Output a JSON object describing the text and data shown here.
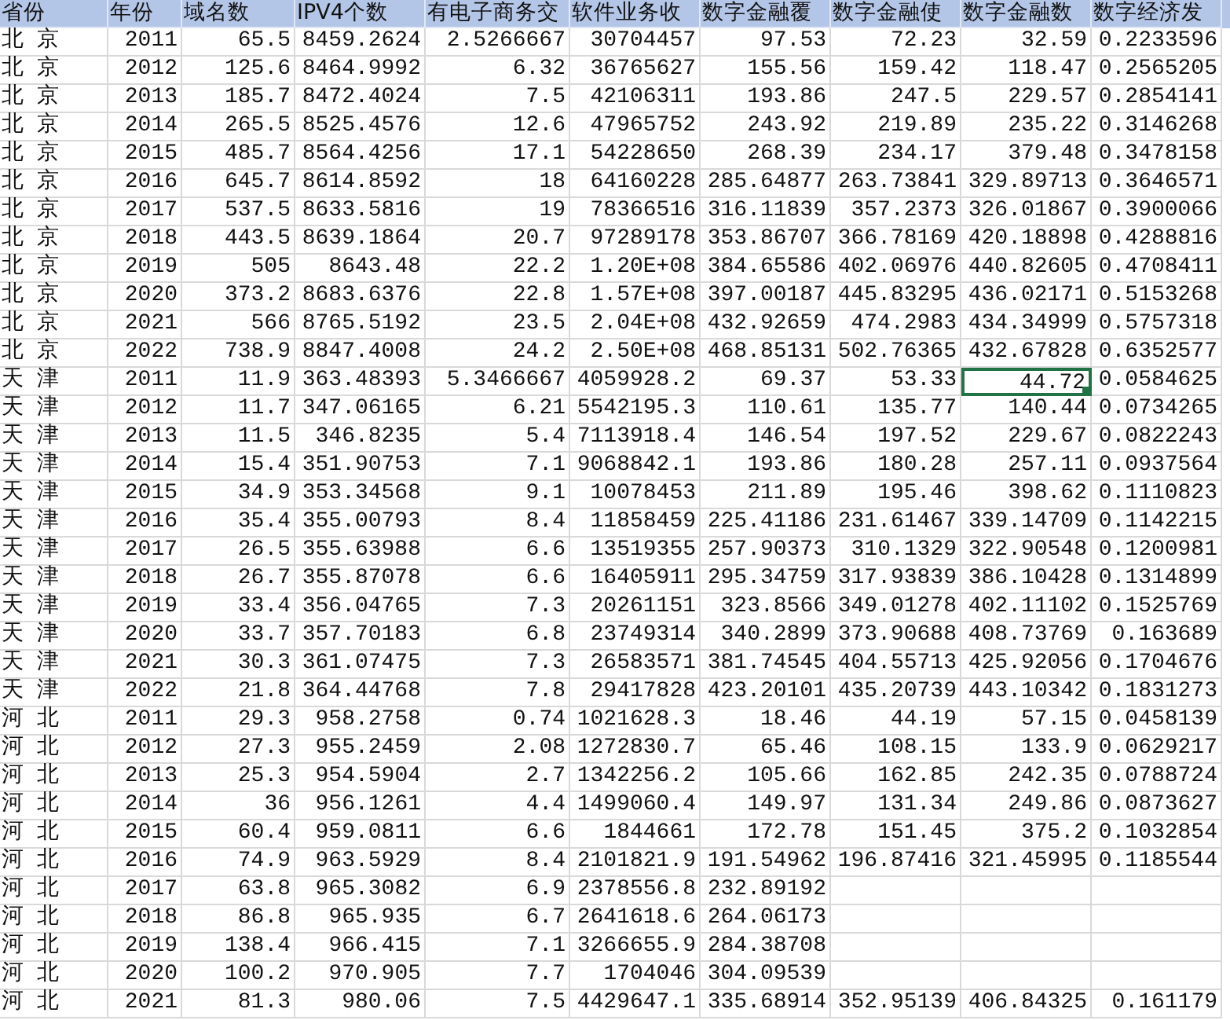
{
  "header": [
    "省份",
    "年份",
    "域名数",
    "IPV4个数",
    "有电子商务交",
    "软件业务收",
    "数字金融覆",
    "数字金融使",
    "数字金融数",
    "数字经济发"
  ],
  "rows": [
    {
      "cells": [
        "北 京",
        "2011",
        "65.5",
        "8459.2624",
        "2.5266667",
        "30704457",
        "97.53",
        "72.23",
        "32.59",
        "0.2233596"
      ]
    },
    {
      "cells": [
        "北 京",
        "2012",
        "125.6",
        "8464.9992",
        "6.32",
        "36765627",
        "155.56",
        "159.42",
        "118.47",
        "0.2565205"
      ]
    },
    {
      "cells": [
        "北 京",
        "2013",
        "185.7",
        "8472.4024",
        "7.5",
        "42106311",
        "193.86",
        "247.5",
        "229.57",
        "0.2854141"
      ]
    },
    {
      "cells": [
        "北 京",
        "2014",
        "265.5",
        "8525.4576",
        "12.6",
        "47965752",
        "243.92",
        "219.89",
        "235.22",
        "0.3146268"
      ]
    },
    {
      "cells": [
        "北 京",
        "2015",
        "485.7",
        "8564.4256",
        "17.1",
        "54228650",
        "268.39",
        "234.17",
        "379.48",
        "0.3478158"
      ]
    },
    {
      "cells": [
        "北 京",
        "2016",
        "645.7",
        "8614.8592",
        "18",
        "64160228",
        "285.64877",
        "263.73841",
        "329.89713",
        "0.3646571"
      ]
    },
    {
      "cells": [
        "北 京",
        "2017",
        "537.5",
        "8633.5816",
        "19",
        "78366516",
        "316.11839",
        "357.2373",
        "326.01867",
        "0.3900066"
      ]
    },
    {
      "cells": [
        "北 京",
        "2018",
        "443.5",
        "8639.1864",
        "20.7",
        "97289178",
        "353.86707",
        "366.78169",
        "420.18898",
        "0.4288816"
      ]
    },
    {
      "cells": [
        "北 京",
        "2019",
        "505",
        "8643.48",
        "22.2",
        "1.20E+08",
        "384.65586",
        "402.06976",
        "440.82605",
        "0.4708411"
      ]
    },
    {
      "cells": [
        "北 京",
        "2020",
        "373.2",
        "8683.6376",
        "22.8",
        "1.57E+08",
        "397.00187",
        "445.83295",
        "436.02171",
        "0.5153268"
      ]
    },
    {
      "cells": [
        "北 京",
        "2021",
        "566",
        "8765.5192",
        "23.5",
        "2.04E+08",
        "432.92659",
        "474.2983",
        "434.34999",
        "0.5757318"
      ]
    },
    {
      "cells": [
        "北 京",
        "2022",
        "738.9",
        "8847.4008",
        "24.2",
        "2.50E+08",
        "468.85131",
        "502.76365",
        "432.67828",
        "0.6352577"
      ]
    },
    {
      "cells": [
        "天 津",
        "2011",
        "11.9",
        "363.48393",
        "5.3466667",
        "4059928.2",
        "69.37",
        "53.33",
        {
          "text": "44.72",
          "selected": true
        },
        "0.0584625"
      ]
    },
    {
      "cells": [
        "天 津",
        "2012",
        "11.7",
        "347.06165",
        "6.21",
        "5542195.3",
        "110.61",
        "135.77",
        "140.44",
        "0.0734265"
      ]
    },
    {
      "cells": [
        "天 津",
        "2013",
        "11.5",
        "346.8235",
        "5.4",
        "7113918.4",
        "146.54",
        "197.52",
        "229.67",
        "0.0822243"
      ]
    },
    {
      "cells": [
        "天 津",
        "2014",
        "15.4",
        "351.90753",
        "7.1",
        "9068842.1",
        "193.86",
        "180.28",
        "257.11",
        "0.0937564"
      ]
    },
    {
      "cells": [
        "天 津",
        "2015",
        "34.9",
        "353.34568",
        "9.1",
        "10078453",
        "211.89",
        "195.46",
        "398.62",
        "0.1110823"
      ]
    },
    {
      "cells": [
        "天 津",
        "2016",
        "35.4",
        "355.00793",
        "8.4",
        "11858459",
        "225.41186",
        "231.61467",
        "339.14709",
        "0.1142215"
      ]
    },
    {
      "cells": [
        "天 津",
        "2017",
        "26.5",
        "355.63988",
        "6.6",
        "13519355",
        "257.90373",
        "310.1329",
        "322.90548",
        "0.1200981"
      ]
    },
    {
      "cells": [
        "天 津",
        "2018",
        "26.7",
        "355.87078",
        "6.6",
        "16405911",
        "295.34759",
        "317.93839",
        "386.10428",
        "0.1314899"
      ]
    },
    {
      "cells": [
        "天 津",
        "2019",
        "33.4",
        "356.04765",
        "7.3",
        "20261151",
        "323.8566",
        "349.01278",
        "402.11102",
        "0.1525769"
      ]
    },
    {
      "cells": [
        "天 津",
        "2020",
        "33.7",
        "357.70183",
        "6.8",
        "23749314",
        "340.2899",
        "373.90688",
        "408.73769",
        "0.163689"
      ]
    },
    {
      "cells": [
        "天 津",
        "2021",
        "30.3",
        "361.07475",
        "7.3",
        "26583571",
        "381.74545",
        "404.55713",
        "425.92056",
        "0.1704676"
      ]
    },
    {
      "cells": [
        "天 津",
        "2022",
        "21.8",
        "364.44768",
        "7.8",
        "29417828",
        "423.20101",
        "435.20739",
        "443.10342",
        "0.1831273"
      ]
    },
    {
      "cells": [
        "河 北",
        "2011",
        "29.3",
        "958.2758",
        "0.74",
        "1021628.3",
        "18.46",
        "44.19",
        "57.15",
        "0.0458139"
      ]
    },
    {
      "cells": [
        "河 北",
        "2012",
        "27.3",
        "955.2459",
        "2.08",
        "1272830.7",
        "65.46",
        "108.15",
        "133.9",
        "0.0629217"
      ]
    },
    {
      "cells": [
        "河 北",
        "2013",
        "25.3",
        "954.5904",
        "2.7",
        "1342256.2",
        "105.66",
        "162.85",
        "242.35",
        "0.0788724"
      ]
    },
    {
      "cells": [
        "河 北",
        "2014",
        "36",
        "956.1261",
        "4.4",
        "1499060.4",
        "149.97",
        "131.34",
        "249.86",
        "0.0873627"
      ]
    },
    {
      "cells": [
        "河 北",
        "2015",
        "60.4",
        "959.0811",
        "6.6",
        "1844661",
        "172.78",
        "151.45",
        "375.2",
        "0.1032854"
      ]
    },
    {
      "cells": [
        "河 北",
        "2016",
        "74.9",
        "963.5929",
        "8.4",
        "2101821.9",
        "191.54962",
        "196.87416",
        "321.45995",
        "0.1185544"
      ]
    },
    {
      "cells": [
        "河 北",
        "2017",
        "63.8",
        "965.3082",
        "6.9",
        "2378556.8",
        "232.89192"
      ]
    },
    {
      "cells": [
        "河 北",
        "2018",
        "86.8",
        "965.935",
        "6.7",
        "2641618.6",
        "264.06173"
      ]
    },
    {
      "cells": [
        "河 北",
        "2019",
        "138.4",
        "966.415",
        "7.1",
        "3266655.9",
        "284.38708"
      ]
    },
    {
      "cells": [
        "河 北",
        "2020",
        "100.2",
        "970.905",
        "7.7",
        "1704046",
        "304.09539"
      ]
    },
    {
      "cells": [
        "河 北",
        "2021",
        "81.3",
        "980.06",
        "7.5",
        "4429647.1",
        "335.68914",
        "352.95139",
        "406.84325",
        "0.161179"
      ]
    }
  ]
}
